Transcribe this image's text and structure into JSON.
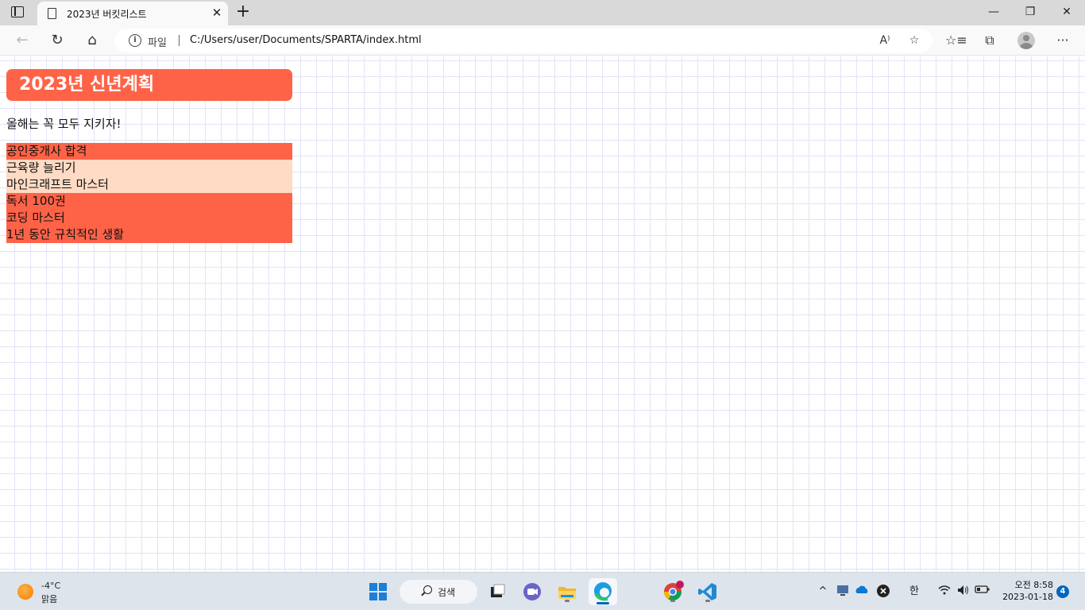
{
  "browser": {
    "tab": {
      "title": "2023년 버킷리스트",
      "close_glyph": "✕"
    },
    "new_tab_glyph": "+",
    "window_controls": {
      "minimize": "—",
      "restore": "❐",
      "close": "✕"
    },
    "nav": {
      "back": "←",
      "refresh": "↻",
      "home": "⌂"
    },
    "address": {
      "scheme_label": "파일",
      "url": "C:/Users/user/Documents/SPARTA/index.html"
    },
    "toolbar_icons": {
      "read_aloud": "A⁾",
      "add_favorite": "☆",
      "favorites": "☆≡",
      "collections": "⧉",
      "more": "···"
    }
  },
  "page": {
    "title": "2023년 신년계획",
    "subtitle": "올해는 꼭 모두 지키자!",
    "goals": [
      "공인중개사 합격",
      "근육량 늘리기",
      "마인크래프트 마스터",
      "독서 100권",
      "코딩 마스터",
      "1년 동안 규칙적인 생활"
    ],
    "colors": {
      "accent": "#ff6347",
      "highlight": "#ffdac4"
    }
  },
  "taskbar": {
    "weather": {
      "temp": "-4°C",
      "desc": "맑음",
      "icon": "sun-icon"
    },
    "search_label": "검색",
    "apps": [
      "task-view",
      "chat",
      "file-explorer",
      "edge",
      "chrome",
      "vscode"
    ],
    "tray": {
      "ime": "한",
      "chevron": "^",
      "battery": "▭"
    },
    "clock": {
      "time": "오전 8:58",
      "date": "2023-01-18"
    },
    "notifications": "4"
  }
}
